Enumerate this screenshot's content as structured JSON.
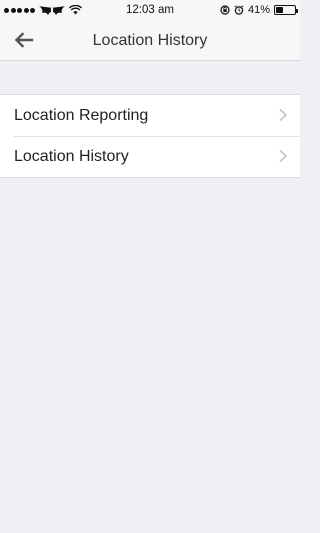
{
  "status_bar": {
    "time": "12:03 am",
    "battery_percent": "41%",
    "battery_level": 0.41,
    "signal_icon": "signal-dots-icon",
    "carrier_icon": "batman-logo-icon",
    "wifi_icon": "wifi-icon",
    "rotation_lock_icon": "rotation-lock-icon",
    "alarm_icon": "alarm-icon"
  },
  "nav": {
    "title": "Location History",
    "back_icon": "back-arrow-icon"
  },
  "list": {
    "items": [
      {
        "label": "Location Reporting",
        "icon": "chevron-right-icon"
      },
      {
        "label": "Location History",
        "icon": "chevron-right-icon"
      }
    ]
  },
  "colors": {
    "background": "#efeff4",
    "bar": "#f7f7f7",
    "chevron": "#c7c7cc"
  }
}
